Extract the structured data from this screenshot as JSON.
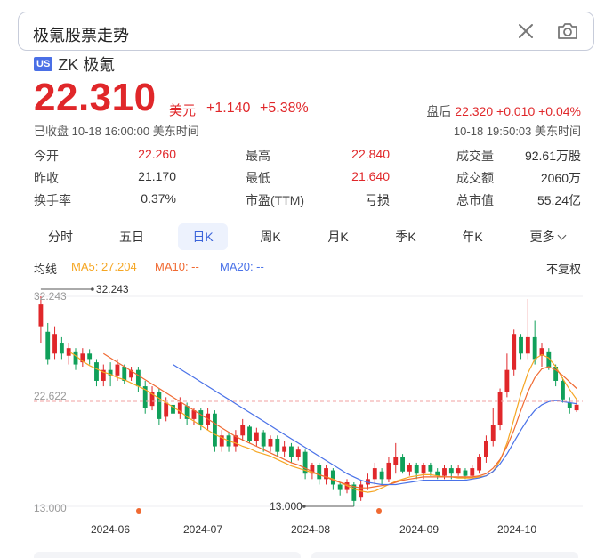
{
  "search": {
    "query": "极氪股票走势"
  },
  "stock": {
    "badge": "US",
    "name": "ZK 极氪",
    "price": "22.310",
    "unit": "美元",
    "change": "+1.140",
    "change_pct": "+5.38%",
    "close_status": "已收盘 10-18 16:00:00 美东时间",
    "after_hours_label": "盘后",
    "after_hours_price": "22.320",
    "after_hours_change": "+0.010",
    "after_hours_pct": "+0.04%",
    "after_hours_time": "10-18 19:50:03 美东时间"
  },
  "stats": [
    [
      {
        "label": "今开",
        "value": "22.260",
        "tone": "red"
      },
      {
        "label": "最高",
        "value": "22.840",
        "tone": "red"
      },
      {
        "label": "成交量",
        "value": "92.61万股",
        "tone": "plain"
      }
    ],
    [
      {
        "label": "昨收",
        "value": "21.170",
        "tone": "plain"
      },
      {
        "label": "最低",
        "value": "21.640",
        "tone": "red"
      },
      {
        "label": "成交额",
        "value": "2060万",
        "tone": "plain"
      }
    ],
    [
      {
        "label": "换手率",
        "value": "0.37%",
        "tone": "plain"
      },
      {
        "label": "市盈(TTM)",
        "value": "亏损",
        "tone": "plain"
      },
      {
        "label": "总市值",
        "value": "55.24亿",
        "tone": "plain"
      }
    ]
  ],
  "tabs": [
    "分时",
    "五日",
    "日K",
    "周K",
    "月K",
    "季K",
    "年K",
    "更多"
  ],
  "active_tab": "日K",
  "ma": {
    "label": "均线",
    "ma5": "MA5: 27.204",
    "ma10": "MA10: --",
    "ma20": "MA20: --",
    "adjust": "不复权"
  },
  "colors": {
    "up": "#e0272a",
    "down": "#10a05a",
    "ma5": "#f5a623",
    "ma10": "#f06a32",
    "ma20": "#4a72e8",
    "accent": "#3b64da"
  },
  "chart_data": {
    "type": "candlestick",
    "y_labels": [
      "32.243",
      "22.622",
      "13.000"
    ],
    "max_marker": "32.243",
    "min_marker": "13.000",
    "current_line": 22.622,
    "x_labels": [
      "2024-06",
      "2024-07",
      "2024-08",
      "2024-09",
      "2024-10"
    ],
    "ylim": [
      13.0,
      32.243
    ],
    "series": [
      {
        "name": "MA5",
        "values": [
          null,
          null,
          null,
          null,
          27.2,
          26.8,
          26.3,
          25.9,
          25.6,
          25.3,
          25.1,
          24.8,
          24.6,
          24.3,
          24.0,
          23.7,
          23.3,
          22.9,
          22.5,
          22.1,
          21.7,
          21.2,
          20.8,
          20.4,
          20.0,
          19.6,
          19.3,
          19.0,
          18.8,
          18.5,
          18.3,
          18.0,
          17.8,
          17.6,
          17.3,
          17.0,
          16.7,
          16.5,
          16.3,
          16.1,
          15.9,
          15.7,
          15.5,
          15.2,
          14.9,
          14.6,
          14.4,
          14.3,
          14.4,
          14.7,
          15.0,
          15.3,
          15.5,
          15.7,
          15.8,
          15.9,
          15.9,
          15.8,
          15.7,
          15.7,
          15.6,
          15.6,
          15.6,
          15.7,
          15.8,
          16.2,
          17.2,
          18.8,
          21.0,
          23.3,
          25.2,
          26.5,
          26.9,
          26.6,
          25.8,
          24.7,
          23.7,
          22.8
        ]
      },
      {
        "name": "MA10",
        "values": [
          null,
          null,
          null,
          null,
          null,
          null,
          null,
          null,
          null,
          27.0,
          26.6,
          26.2,
          25.8,
          25.4,
          25.0,
          24.6,
          24.2,
          23.8,
          23.4,
          23.0,
          22.6,
          22.2,
          21.8,
          21.4,
          21.0,
          20.6,
          20.2,
          19.8,
          19.4,
          19.1,
          18.8,
          18.5,
          18.2,
          17.9,
          17.6,
          17.3,
          17.0,
          16.8,
          16.5,
          16.2,
          15.9,
          15.7,
          15.4,
          15.2,
          15.0,
          14.8,
          14.7,
          14.7,
          14.8,
          14.9,
          15.0,
          15.2,
          15.4,
          15.5,
          15.6,
          15.7,
          15.7,
          15.7,
          15.7,
          15.7,
          15.7,
          15.7,
          15.7,
          15.8,
          16.0,
          16.5,
          17.3,
          18.5,
          20.0,
          21.8,
          23.5,
          24.8,
          25.6,
          25.8,
          25.5,
          25.0,
          24.4,
          23.8
        ]
      },
      {
        "name": "MA20",
        "values": [
          null,
          null,
          null,
          null,
          null,
          null,
          null,
          null,
          null,
          null,
          null,
          null,
          null,
          null,
          null,
          null,
          null,
          null,
          null,
          26.0,
          25.6,
          25.2,
          24.8,
          24.4,
          24.0,
          23.6,
          23.2,
          22.8,
          22.4,
          22.0,
          21.6,
          21.2,
          20.8,
          20.4,
          20.0,
          19.6,
          19.2,
          18.8,
          18.4,
          18.0,
          17.6,
          17.2,
          16.8,
          16.4,
          16.0,
          15.7,
          15.4,
          15.2,
          15.1,
          15.0,
          15.0,
          15.0,
          15.1,
          15.2,
          15.3,
          15.4,
          15.4,
          15.4,
          15.4,
          15.4,
          15.4,
          15.4,
          15.5,
          15.6,
          15.8,
          16.2,
          16.9,
          17.8,
          18.9,
          20.0,
          21.0,
          21.8,
          22.3,
          22.6,
          22.7,
          22.6,
          22.5,
          22.4
        ]
      }
    ],
    "candles": [
      [
        29.5,
        31.5,
        28.0,
        32.243
      ],
      [
        29.0,
        26.5,
        26.0,
        29.8
      ],
      [
        27.0,
        28.8,
        26.5,
        29.5
      ],
      [
        28.0,
        27.0,
        26.5,
        28.5
      ],
      [
        26.8,
        27.5,
        26.0,
        28.0
      ],
      [
        27.2,
        26.0,
        25.5,
        27.5
      ],
      [
        26.2,
        27.0,
        25.8,
        27.5
      ],
      [
        27.0,
        26.5,
        26.0,
        27.4
      ],
      [
        26.2,
        24.5,
        24.0,
        26.5
      ],
      [
        24.5,
        25.5,
        24.0,
        26.0
      ],
      [
        25.5,
        25.0,
        24.0,
        26.2
      ],
      [
        25.0,
        26.0,
        24.5,
        26.5
      ],
      [
        25.8,
        24.5,
        24.2,
        26.0
      ],
      [
        24.8,
        25.5,
        24.5,
        25.8
      ],
      [
        25.5,
        24.0,
        23.5,
        25.8
      ],
      [
        24.0,
        22.0,
        21.5,
        24.5
      ],
      [
        22.2,
        23.5,
        21.8,
        24.0
      ],
      [
        23.5,
        21.0,
        20.5,
        23.8
      ],
      [
        21.2,
        22.5,
        20.8,
        23.0
      ],
      [
        22.3,
        21.5,
        21.0,
        22.8
      ],
      [
        21.5,
        22.5,
        21.0,
        23.0
      ],
      [
        22.2,
        21.0,
        20.5,
        22.5
      ],
      [
        21.0,
        21.8,
        20.5,
        22.0
      ],
      [
        21.8,
        20.5,
        20.0,
        22.0
      ],
      [
        20.5,
        21.5,
        20.0,
        22.0
      ],
      [
        21.5,
        18.5,
        18.0,
        21.8
      ],
      [
        18.5,
        19.5,
        18.0,
        20.0
      ],
      [
        19.5,
        18.5,
        18.0,
        19.8
      ],
      [
        18.5,
        19.5,
        18.0,
        20.0
      ],
      [
        19.5,
        20.5,
        19.0,
        21.0
      ],
      [
        20.3,
        19.0,
        18.8,
        20.5
      ],
      [
        19.0,
        19.8,
        18.5,
        20.2
      ],
      [
        19.8,
        18.5,
        18.0,
        20.0
      ],
      [
        18.5,
        19.2,
        18.0,
        19.5
      ],
      [
        19.2,
        18.0,
        17.5,
        19.5
      ],
      [
        18.0,
        18.5,
        17.5,
        19.0
      ],
      [
        18.5,
        17.5,
        17.0,
        18.8
      ],
      [
        17.5,
        18.2,
        17.2,
        18.5
      ],
      [
        18.0,
        16.0,
        15.5,
        18.2
      ],
      [
        16.0,
        16.8,
        15.5,
        17.0
      ],
      [
        16.8,
        15.5,
        15.0,
        17.0
      ],
      [
        15.5,
        16.5,
        15.0,
        16.8
      ],
      [
        16.3,
        15.0,
        14.5,
        16.5
      ],
      [
        15.0,
        14.5,
        14.0,
        15.2
      ],
      [
        14.5,
        15.2,
        14.2,
        15.5
      ],
      [
        15.0,
        13.5,
        13.0,
        15.2
      ],
      [
        13.8,
        15.0,
        13.5,
        15.3
      ],
      [
        15.0,
        15.5,
        14.5,
        16.0
      ],
      [
        15.5,
        16.5,
        15.0,
        17.0
      ],
      [
        16.2,
        15.5,
        15.0,
        16.5
      ],
      [
        15.5,
        17.0,
        15.2,
        17.5
      ],
      [
        16.8,
        17.5,
        16.0,
        18.8
      ],
      [
        17.5,
        16.2,
        16.0,
        17.8
      ],
      [
        16.2,
        16.8,
        15.8,
        17.0
      ],
      [
        16.8,
        16.0,
        15.5,
        17.0
      ],
      [
        16.0,
        16.8,
        15.5,
        17.0
      ],
      [
        16.8,
        16.2,
        15.8,
        17.0
      ],
      [
        16.2,
        15.8,
        15.5,
        16.5
      ],
      [
        15.8,
        16.5,
        15.5,
        16.8
      ],
      [
        16.5,
        16.0,
        15.5,
        16.8
      ],
      [
        16.0,
        16.5,
        15.8,
        16.8
      ],
      [
        16.3,
        15.8,
        15.5,
        16.5
      ],
      [
        15.8,
        16.5,
        15.5,
        16.8
      ],
      [
        16.3,
        17.5,
        16.0,
        17.8
      ],
      [
        17.5,
        19.0,
        17.0,
        19.5
      ],
      [
        19.0,
        20.5,
        18.5,
        22.0
      ],
      [
        20.5,
        23.5,
        20.0,
        23.8
      ],
      [
        23.5,
        25.5,
        23.0,
        27.0
      ],
      [
        25.5,
        28.8,
        25.0,
        29.2
      ],
      [
        28.5,
        27.0,
        26.5,
        28.8
      ],
      [
        27.0,
        28.5,
        26.5,
        32.0
      ],
      [
        28.5,
        26.5,
        26.0,
        30.0
      ],
      [
        26.8,
        27.5,
        25.8,
        28.0
      ],
      [
        27.2,
        25.8,
        25.5,
        27.5
      ],
      [
        25.8,
        24.5,
        24.0,
        26.0
      ],
      [
        24.5,
        22.8,
        22.5,
        24.8
      ],
      [
        22.5,
        22.0,
        21.5,
        23.0
      ],
      [
        21.8,
        22.31,
        21.64,
        22.84
      ]
    ]
  }
}
